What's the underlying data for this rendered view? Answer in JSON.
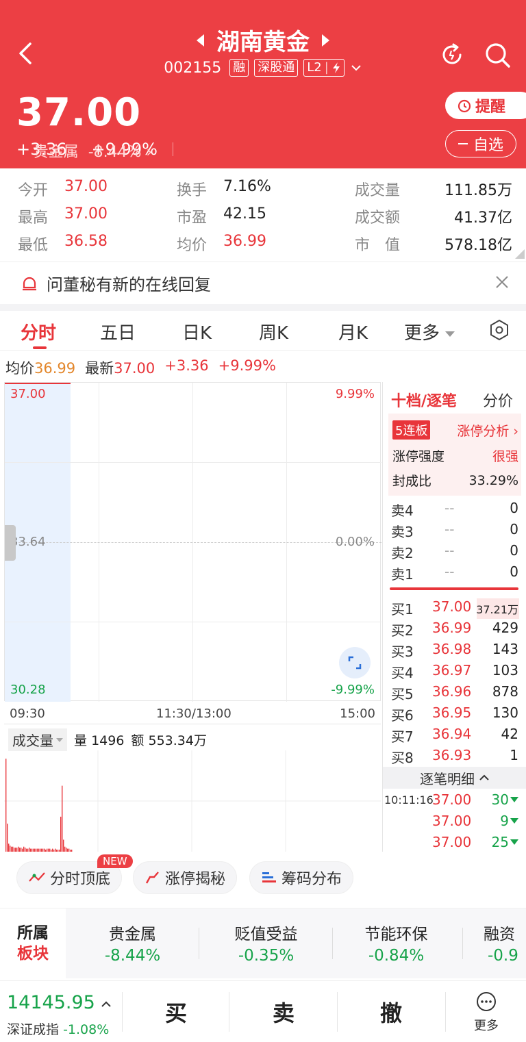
{
  "header": {
    "title": "湖南黄金",
    "code": "002155",
    "tags": [
      "融",
      "深股通",
      "L2"
    ],
    "price": "37.00",
    "change": "+3.36",
    "change_pct": "+9.99%",
    "sector_name": "贵金属",
    "sector_pct": "-8.44%",
    "remind_label": "提醒",
    "watch_label": "自选",
    "bg_color": "#ec3f44"
  },
  "stats": [
    {
      "k": "今开",
      "v": "37.00",
      "red": true
    },
    {
      "k": "换手",
      "v": "7.16%",
      "red": false
    },
    {
      "k": "成交量",
      "v": "111.85万",
      "red": false
    },
    {
      "k": "最高",
      "v": "37.00",
      "red": true
    },
    {
      "k": "市盈",
      "v": "42.15",
      "red": false
    },
    {
      "k": "成交额",
      "v": "41.37亿",
      "red": false
    },
    {
      "k": "最低",
      "v": "36.58",
      "red": true
    },
    {
      "k": "均价",
      "v": "36.99",
      "red": true
    },
    {
      "k": "市　值",
      "v": "578.18亿",
      "red": false
    }
  ],
  "notice": "问董秘有新的在线回复",
  "tabs": [
    "分时",
    "五日",
    "日K",
    "周K",
    "月K",
    "更多"
  ],
  "quote": {
    "avg_label": "均价",
    "avg": "36.99",
    "latest_label": "最新",
    "latest": "37.00",
    "change": "+3.36",
    "pct": "+9.99%"
  },
  "chart_axis": {
    "top_price": "37.00",
    "mid_price": "33.64",
    "bot_price": "30.28",
    "top_pct": "9.99%",
    "mid_pct": "0.00%",
    "bot_pct": "-9.99%",
    "t_start": "09:30",
    "t_mid": "11:30/13:00",
    "t_end": "15:00"
  },
  "volume": {
    "select_label": "成交量",
    "vol_label": "量",
    "vol": "1496",
    "amt_label": "额",
    "amt": "553.34万"
  },
  "chart_data": {
    "type": "bar",
    "title": "成交量",
    "bars": [
      0.93,
      0.28,
      0.08,
      0.06,
      0.05,
      0.05,
      0.04,
      0.04,
      0.04,
      0.05,
      0.04,
      0.04,
      0.03,
      0.05,
      0.04,
      0.03,
      0.03,
      0.04,
      0.03,
      0.03,
      0.03,
      0.03,
      0.03,
      0.03,
      0.03,
      0.03,
      0.03,
      0.03,
      0.03,
      0.02,
      0.03,
      0.03,
      0.03,
      0.02,
      0.03,
      0.02,
      0.03,
      0.02,
      0.02,
      0.02,
      0.35,
      0.66,
      0.12,
      0.05,
      0.04,
      0.03,
      0.03,
      0.02,
      0.02
    ],
    "bar_color": "#e8353a"
  },
  "orderbook": {
    "title": "十档/逐笔",
    "alt": "分价",
    "streak": "5连板",
    "analysis": "涨停分析",
    "strength_label": "涨停强度",
    "strength": "很强",
    "seal_label": "封成比",
    "seal": "33.29%",
    "asks": [
      {
        "n": "卖4",
        "p": "--",
        "q": "0"
      },
      {
        "n": "卖3",
        "p": "--",
        "q": "0"
      },
      {
        "n": "卖2",
        "p": "--",
        "q": "0"
      },
      {
        "n": "卖1",
        "p": "--",
        "q": "0"
      }
    ],
    "bids": [
      {
        "n": "买1",
        "p": "37.00",
        "q": "37.21万"
      },
      {
        "n": "买2",
        "p": "36.99",
        "q": "429"
      },
      {
        "n": "买3",
        "p": "36.98",
        "q": "143"
      },
      {
        "n": "买4",
        "p": "36.97",
        "q": "103"
      },
      {
        "n": "买5",
        "p": "36.96",
        "q": "878"
      },
      {
        "n": "买6",
        "p": "36.95",
        "q": "130"
      },
      {
        "n": "买7",
        "p": "36.94",
        "q": "42"
      },
      {
        "n": "买8",
        "p": "36.93",
        "q": "1"
      }
    ],
    "tick_title": "逐笔明细",
    "ticks": [
      {
        "t": "10:11:16",
        "p": "37.00",
        "v": "30"
      },
      {
        "t": "",
        "p": "37.00",
        "v": "9"
      },
      {
        "t": "",
        "p": "37.00",
        "v": "25"
      }
    ]
  },
  "features": {
    "f1": "分时顶底",
    "f2": "涨停揭秘",
    "f3": "筹码分布",
    "new_badge": "NEW"
  },
  "sectors": {
    "label1": "所属",
    "label2": "板块",
    "items": [
      {
        "name": "贵金属",
        "pct": "-8.44%"
      },
      {
        "name": "贬值受益",
        "pct": "-0.35%"
      },
      {
        "name": "节能环保",
        "pct": "-0.84%"
      },
      {
        "name": "融资",
        "pct": "-0.9"
      }
    ]
  },
  "bottom": {
    "index_value": "14145.95",
    "index_name": "深证成指",
    "index_pct": "-1.08%",
    "buy": "买",
    "sell": "卖",
    "cancel": "撤",
    "more": "更多"
  }
}
